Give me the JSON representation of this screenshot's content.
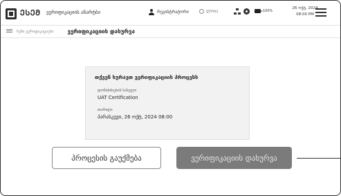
{
  "header": {
    "logo_text": "ᲔᲡᲔᲛ",
    "app_title": "ვერიფიკაციის ანარტბი",
    "user_name": "რეგისტრატორი",
    "language": "ლოია",
    "battery_level": "100%",
    "date": "26 ოქტ, 2024",
    "time": "08:00 PM"
  },
  "breadcrumb": {
    "previous": "ჩემი ვერიფიკაციები",
    "current": "ვერიფიკაციის დახურვა"
  },
  "card": {
    "title": "თქვენ ხურავთ ვერიფიკაციის პროცესს",
    "fields": [
      {
        "label": "დონისძიების სახელი",
        "value": "UAT Certification"
      },
      {
        "label": "თარიღი",
        "value": "პარასკევი, 26 ოქტ, 2024 08:00"
      }
    ]
  },
  "actions": {
    "cancel_label": "პროცესის გაუქმება",
    "close_label": "ვერიფიკაციის დახურვა"
  },
  "colors": {
    "primary_button": "#7b7b7b",
    "card_background": "#f2f2f2",
    "frame_border": "#2d2d2d"
  }
}
